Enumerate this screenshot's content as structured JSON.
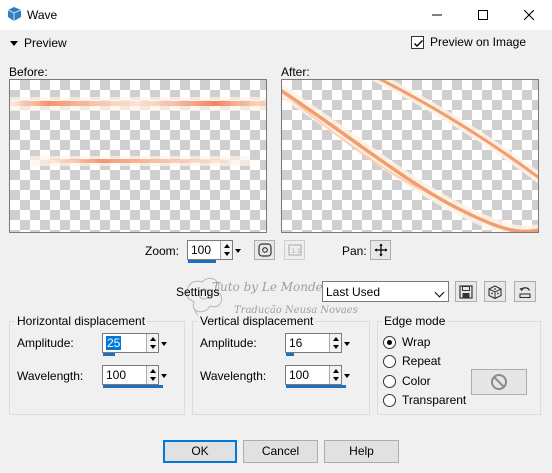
{
  "window": {
    "title": "Wave",
    "icon": "psp-app-icon",
    "controls": [
      "minimize-icon",
      "maximize-icon",
      "close-icon"
    ]
  },
  "preview": {
    "toggle_label": "Preview",
    "preview_on_image_label": "Preview on Image",
    "preview_on_image_checked": true,
    "before_label": "Before:",
    "after_label": "After:"
  },
  "zoom": {
    "label": "Zoom:",
    "value": "100",
    "pan_label": "Pan:"
  },
  "settings": {
    "label": "Settings",
    "selected": "Last Used"
  },
  "horizontal": {
    "title": "Horizontal displacement",
    "amplitude_label": "Amplitude:",
    "amplitude": "25",
    "wavelength_label": "Wavelength:",
    "wavelength": "100"
  },
  "vertical": {
    "title": "Vertical displacement",
    "amplitude_label": "Amplitude:",
    "amplitude": "16",
    "wavelength_label": "Wavelength:",
    "wavelength": "100"
  },
  "edge_mode": {
    "title": "Edge mode",
    "options": [
      "Wrap",
      "Repeat",
      "Color",
      "Transparent"
    ],
    "selected": "Wrap"
  },
  "buttons": {
    "ok": "OK",
    "cancel": "Cancel",
    "help": "Help"
  },
  "watermark": {
    "line1": "Tuto by Le Monde de Bea",
    "line2": "Tradução Neusa Novaes"
  },
  "colors": {
    "accent": "#0078d7",
    "slider": "#1f6fc1",
    "glow": "#f08a5d"
  }
}
